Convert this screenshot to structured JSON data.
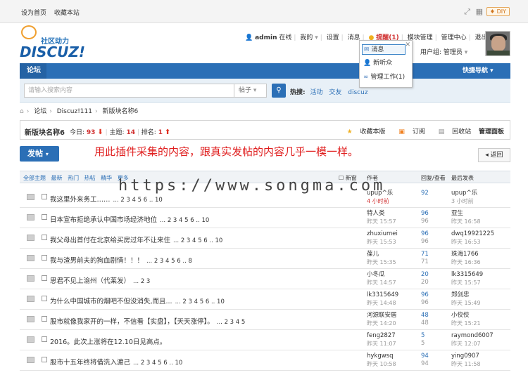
{
  "topbar": {
    "home_label": "设为首页",
    "fav_label": "收藏本站",
    "diy_label": "♦ DIY"
  },
  "logo": {
    "tagline": "社区动力",
    "wordmark": "DISCUZ!"
  },
  "user": {
    "name": "admin",
    "status": "在线",
    "mine": "我的",
    "settings": "设置",
    "messages": "消息",
    "reminders": "提醒(1)",
    "module_admin": "模块管理",
    "admin_center": "管理中心",
    "logout": "退出",
    "group_label": "用户组: 管理员"
  },
  "reminder_popup": {
    "items": [
      "消息",
      "新听众",
      "管理工作(1)"
    ]
  },
  "nav": {
    "current": "论坛",
    "quick_nav": "快捷导航"
  },
  "search": {
    "placeholder": "请输入搜索内容",
    "type": "帖子",
    "hot_label": "热搜:",
    "hot_terms": [
      "活动",
      "交友",
      "discuz"
    ]
  },
  "breadcrumb": [
    "论坛",
    "Discuz!111",
    "新版块名称6"
  ],
  "forum": {
    "name": "新版块名称6",
    "today_label": "今日:",
    "today": "93",
    "topics_label": "主题:",
    "topics": "14",
    "rank_label": "排名:",
    "rank": "1",
    "actions": [
      "收藏本版",
      "订阅",
      "回收站",
      "管理面板"
    ]
  },
  "post_button": "发帖",
  "announcement": "用此插件采集的内容，跟真实发帖的内容几乎一模一样。",
  "back_button": "◂ 返回",
  "filters": {
    "items": [
      "全部主题",
      "最新",
      "热门",
      "热帖",
      "精华",
      "更多"
    ],
    "col_new": "新窗",
    "col_author": "作者",
    "col_replies": "回复/查看",
    "col_last": "最后发表"
  },
  "watermark": "https://www.songma.com",
  "threads": [
    {
      "title": "我这里外来务工……",
      "pages": "... 2 3 4 5 6 .. 10",
      "author": "upup^乐",
      "date": "4 小时前",
      "date_red": true,
      "replies": "92",
      "views": "",
      "last_user": "upup^乐",
      "last_time": "3 小时前"
    },
    {
      "title": "日本宣布拒绝承认中国市场经济地位",
      "pages": "... 2 3 4 5 6 .. 10",
      "author": "特人类",
      "date": "昨天 15:57",
      "date_red": false,
      "replies": "96",
      "views": "96",
      "last_user": "亚生",
      "last_time": "昨天 16:58"
    },
    {
      "title": "我父母出首付在北京给买房过年不让来住",
      "pages": "... 2 3 4 5 6 .. 10",
      "author": "zhuxiumei",
      "date": "昨天 15:53",
      "date_red": false,
      "replies": "96",
      "views": "96",
      "last_user": "dwq19921225",
      "last_time": "昨天 16:53"
    },
    {
      "title": "我与渣男前夫的狗血剧情！！！",
      "pages": "... 2 3 4 5 6 .. 8",
      "author": "葆儿",
      "date": "昨天 15:35",
      "date_red": false,
      "replies": "71",
      "views": "71",
      "last_user": "珠海1766",
      "last_time": "昨天 16:36"
    },
    {
      "title": "思君不见上渝州（代莱发）",
      "pages": "... 2 3",
      "author": "小冬瓜",
      "date": "昨天 14:57",
      "date_red": false,
      "replies": "20",
      "views": "20",
      "last_user": "lk3315649",
      "last_time": "昨天 15:57"
    },
    {
      "title": "为什么中国城市的烟吧不但没消失,而且...",
      "pages": "... 2 3 4 5 6 .. 10",
      "author": "lk3315649",
      "date": "昨天 14:48",
      "date_red": false,
      "replies": "96",
      "views": "96",
      "last_user": "郑剑忠",
      "last_time": "昨天 15:49"
    },
    {
      "title": "股市就像我家开的一样，不信看【实盘】，【天天涨停】。",
      "pages": "... 2 3 4 5",
      "author": "河源联安居",
      "date": "昨天 14:20",
      "date_red": false,
      "replies": "48",
      "views": "48",
      "last_user": "小佼佼",
      "last_time": "昨天 15:21"
    },
    {
      "title": "2016。此次上涨将在12.10日见高点。",
      "pages": "",
      "author": "feng2827",
      "date": "昨天 11:07",
      "date_red": false,
      "replies": "5",
      "views": "5",
      "last_user": "raymond6007",
      "last_time": "昨天 12:07"
    },
    {
      "title": "股市十五年终将借洗入渡己",
      "pages": "... 2 3 4 5 6 .. 10",
      "author": "hykgwsq",
      "date": "昨天 10:58",
      "date_red": false,
      "replies": "94",
      "views": "94",
      "last_user": "ying0907",
      "last_time": "昨天 11:58"
    }
  ]
}
